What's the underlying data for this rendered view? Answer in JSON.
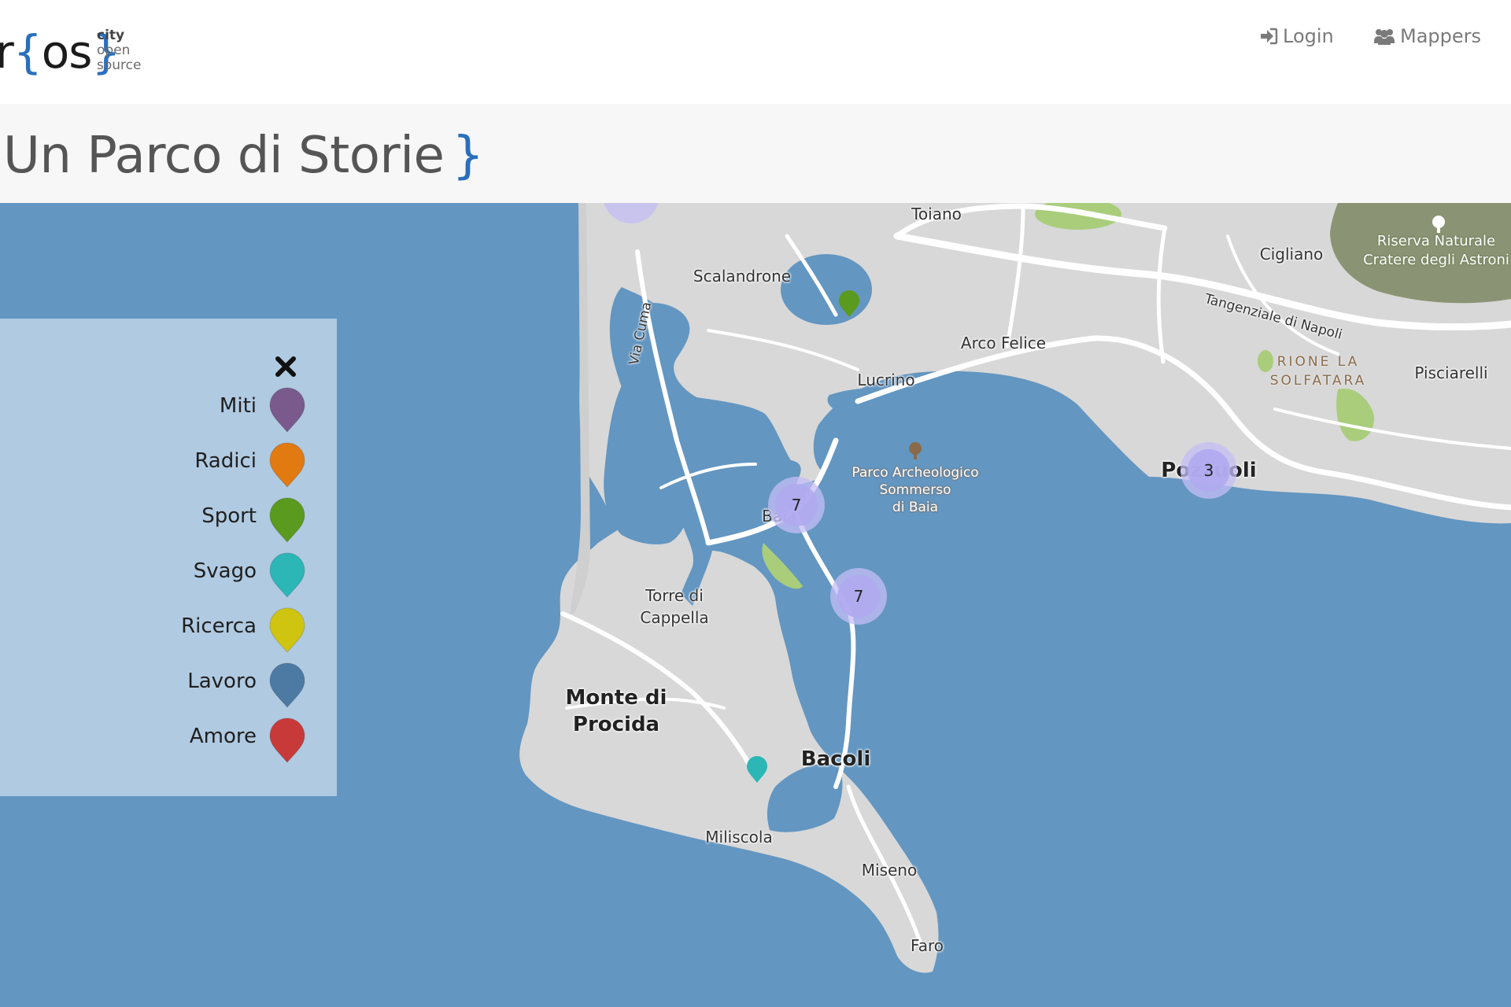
{
  "header": {
    "logo": {
      "main_left": "r",
      "brace_open": "{",
      "main_mid": "os",
      "brace_close": "}",
      "line1": "city",
      "line2": "open",
      "line3": "source"
    },
    "nav": [
      {
        "label": "Login",
        "icon": "sign-in-icon"
      },
      {
        "label": "Mappers",
        "icon": "users-icon"
      }
    ]
  },
  "page": {
    "title": "Un Parco di Storie",
    "title_brace": "}"
  },
  "legend": {
    "close_icon": "close-icon",
    "items": [
      {
        "label": "Miti",
        "color": "#7a5a8c"
      },
      {
        "label": "Radici",
        "color": "#e17a11"
      },
      {
        "label": "Sport",
        "color": "#5a9a1e"
      },
      {
        "label": "Svago",
        "color": "#2cb6b6"
      },
      {
        "label": "Ricerca",
        "color": "#cfc410"
      },
      {
        "label": "Lavoro",
        "color": "#4d7aa3"
      },
      {
        "label": "Amore",
        "color": "#c83a3a"
      }
    ]
  },
  "map": {
    "places": {
      "toiano": "Toiano",
      "scalandrone": "Scalandrone",
      "cigliano": "Cigliano",
      "via_cuma": "Via Cuma",
      "arco_felice": "Arco Felice",
      "lucrino": "Lucrino",
      "tangenziale": "Tangenziale di Napoli",
      "rione_1": "RIONE LA",
      "rione_2": "SOLFATARA",
      "pisciarelli": "Pisciarelli",
      "parco_1": "Parco Archeologico",
      "parco_2": "Sommerso",
      "parco_3": "di Baia",
      "riserva_1": "Riserva Naturale",
      "riserva_2": "Cratere degli Astroni",
      "pozzuoli": "Pozzuoli",
      "baia": "Baia",
      "torre_1": "Torre di",
      "torre_2": "Cappella",
      "monte_1": "Monte di",
      "monte_2": "Procida",
      "bacoli": "Bacoli",
      "miliscola": "Miliscola",
      "miseno": "Miseno",
      "faro": "Faro"
    },
    "clusters": [
      {
        "count": "7"
      },
      {
        "count": "7"
      },
      {
        "count": "3"
      }
    ],
    "markers": [
      {
        "category": "Sport",
        "color": "#5a9a1e"
      },
      {
        "category": "Svago",
        "color": "#2cb6b6"
      }
    ],
    "colors": {
      "sea": "#6396c1",
      "land": "#d9d9d9",
      "park": "#a9cd7b",
      "crater": "#8a9474"
    }
  }
}
